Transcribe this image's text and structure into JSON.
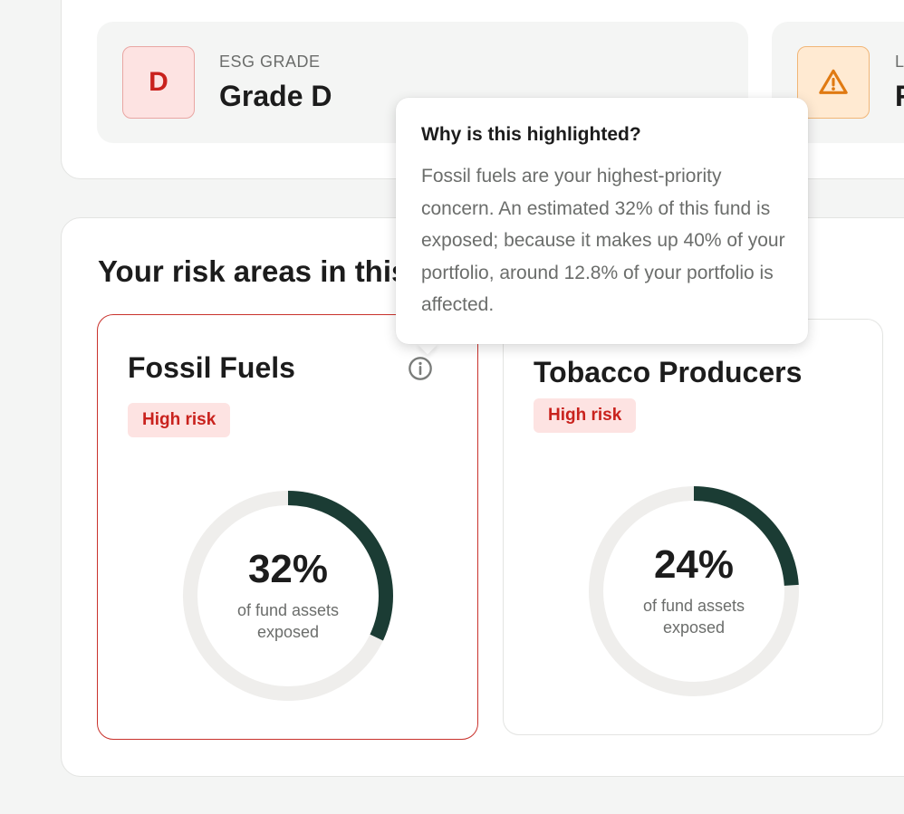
{
  "summary": {
    "esg": {
      "badge": "D",
      "label": "ESG GRADE",
      "value": "Grade D",
      "color": "#c9221d"
    },
    "second_metric": {
      "icon": "warning-icon",
      "label": "L",
      "value": "F",
      "color": "#e07a12"
    }
  },
  "risk_section": {
    "title": "Your risk areas in this fund"
  },
  "risk_areas": [
    {
      "name": "Fossil Fuels",
      "risk_label": "High risk",
      "percent_text": "32%",
      "percent": 32,
      "caption": "of fund assets exposed",
      "has_info": true
    },
    {
      "name": "Tobacco Producers",
      "risk_label": "High risk",
      "percent_text": "24%",
      "percent": 24,
      "caption": "of fund assets exposed",
      "has_info": false
    }
  ],
  "tooltip": {
    "title": "Why is this highlighted?",
    "body": "Fossil fuels are your highest-priority concern. An estimated 32% of this fund is exposed; because it makes up 40% of your portfolio, around 12.8% of your portfolio is affected."
  },
  "colors": {
    "donut_fill": "#1b3c34",
    "donut_track": "#efeeec",
    "high_risk": "#c9221d",
    "high_risk_bg": "#fde3e2"
  }
}
